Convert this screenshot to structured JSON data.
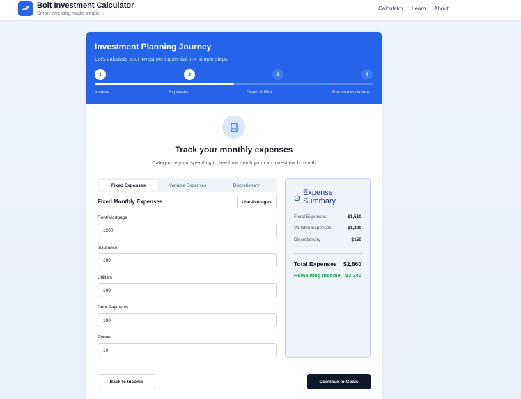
{
  "header": {
    "app_title": "Bolt Investment Calculator",
    "tagline": "Smart investing made simple",
    "nav": [
      "Calculator",
      "Learn",
      "About"
    ],
    "logo_icon": "trending-up-icon"
  },
  "hero": {
    "title": "Investment Planning Journey",
    "subtitle": "Let's calculate your investment potential in 4 simple steps",
    "progress_percent": 50,
    "steps": [
      {
        "number": "1",
        "label": "Income",
        "state": "done"
      },
      {
        "number": "2",
        "label": "Expenses",
        "state": "current"
      },
      {
        "number": "3",
        "label": "Goals & Risk",
        "state": "todo"
      },
      {
        "number": "4",
        "label": "Recommendations",
        "state": "todo"
      }
    ]
  },
  "section": {
    "icon": "calculator-icon",
    "title": "Track your monthly expenses",
    "subtitle": "Categorize your spending to see how much you can invest each month"
  },
  "tabs": [
    {
      "label": "Fixed Expenses",
      "active": true
    },
    {
      "label": "Variable Expenses",
      "active": false
    },
    {
      "label": "Discretionary",
      "active": false
    }
  ],
  "fixed": {
    "title": "Fixed Monthly Expenses",
    "use_averages": "Use Averages",
    "fields": [
      {
        "label": "Rent/Mortgage",
        "value": "1200"
      },
      {
        "label": "Insurance",
        "value": "100"
      },
      {
        "label": "Utilities",
        "value": "100"
      },
      {
        "label": "Debt Payments",
        "value": "100"
      },
      {
        "label": "Phone",
        "value": "10"
      }
    ]
  },
  "summary": {
    "icon": "clock-icon",
    "title_line1": "Expense",
    "title_line2": "Summary",
    "rows": [
      {
        "label": "Fixed Expenses",
        "value": "$1,510"
      },
      {
        "label": "Variable Expenses",
        "value": "$1,200"
      },
      {
        "label": "Discretionary",
        "value": "$150"
      }
    ],
    "total_label": "Total Expenses",
    "total_value": "$2,860",
    "remaining_label": "Remaining Income",
    "remaining_value": "$3,340"
  },
  "actions": {
    "back": "Back to Income",
    "next": "Continue to Goals"
  },
  "colors": {
    "primary": "#2563eb",
    "dark_button": "#0f172a",
    "success": "#16a34a"
  }
}
